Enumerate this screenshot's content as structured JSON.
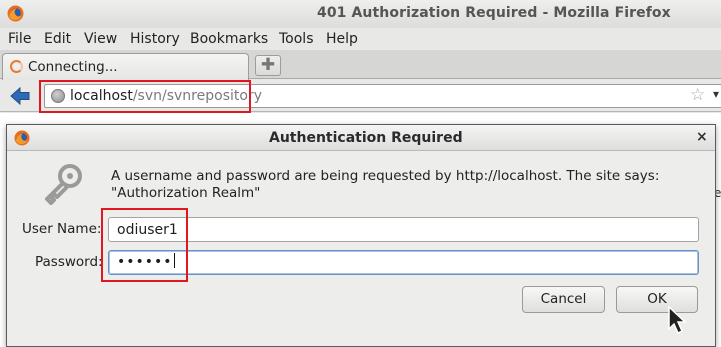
{
  "window": {
    "title": "401 Authorization Required - Mozilla Firefox"
  },
  "menu": [
    "File",
    "Edit",
    "View",
    "History",
    "Bookmarks",
    "Tools",
    "Help"
  ],
  "tab": {
    "label": "Connecting..."
  },
  "urlbar": {
    "host": "localhost",
    "path": "/svn/svnrepository"
  },
  "dialog": {
    "title": "Authentication Required",
    "message": "A username and password are being requested by http://localhost. The site says: \"Authorization Realm\"",
    "username_label": "User Name:",
    "username_value": "odiuser1",
    "password_label": "Password:",
    "password_value": "••••••",
    "cancel_label": "Cancel",
    "ok_label": "OK"
  },
  "colors": {
    "annotation": "#e0171e",
    "focus": "#6d8fc0"
  },
  "icons": [
    "firefox-icon",
    "spinner-icon",
    "new-tab-icon",
    "back-arrow-icon",
    "globe-icon",
    "star-icon",
    "dropdown-icon",
    "key-icon",
    "close-icon",
    "cursor-icon"
  ]
}
